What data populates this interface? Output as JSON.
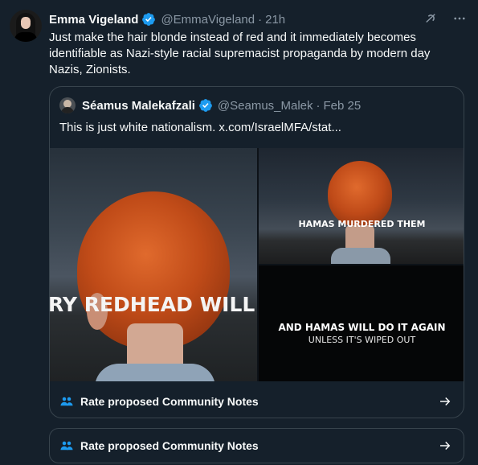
{
  "tweet": {
    "name": "Emma Vigeland",
    "handle": "@EmmaVigeland",
    "separator": "·",
    "time": "21h",
    "text": "Just make the hair blonde instead of red and it immediately becomes identifiable as Nazi-style racial supremacist propaganda by modern day Nazis, Zionists."
  },
  "quote": {
    "name": "Séamus Malekafzali",
    "handle": "@Seamus_Malek",
    "separator": "·",
    "time": "Feb 25",
    "text": "This is just white nationalism.  x.com/IsraelMFA/stat..."
  },
  "media": {
    "left_caption": "RY REDHEAD WILL REMIN",
    "top_right_caption": "HAMAS MURDERED THEM",
    "bottom_right_caption_1": "AND HAMAS WILL DO IT AGAIN",
    "bottom_right_caption_2": "UNLESS IT'S WIPED OUT"
  },
  "community_notes": {
    "inner_label": "Rate proposed Community Notes",
    "outer_label": "Rate proposed Community Notes"
  },
  "icons": {
    "verified": "verified-badge-icon",
    "grok": "grok-icon",
    "more": "more-icon",
    "people": "people-icon",
    "arrow": "arrow-right-icon"
  },
  "colors": {
    "background": "#15202b",
    "verified": "#1d9bf0",
    "secondary_text": "#8b98a5",
    "border": "#38444d"
  }
}
